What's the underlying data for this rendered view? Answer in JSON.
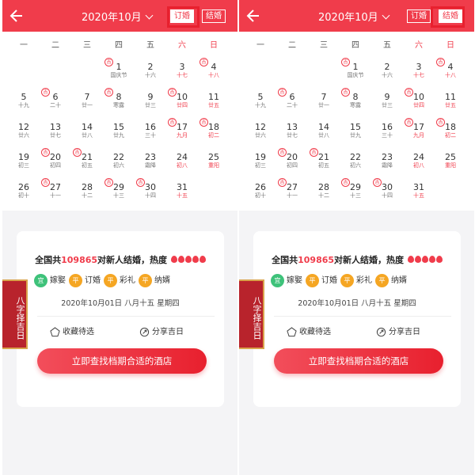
{
  "header": {
    "month": "2020年10月",
    "tab_dinghun": "订婚",
    "tab_jiehun": "结婚"
  },
  "weekdays": [
    "一",
    "二",
    "三",
    "四",
    "五",
    "六",
    "日"
  ],
  "ji_label": "吉",
  "days": [
    {
      "n": "1",
      "s": "国庆节",
      "red": false,
      "ji": true
    },
    {
      "n": "2",
      "s": "十六",
      "red": false,
      "ji": false
    },
    {
      "n": "3",
      "s": "十七",
      "red": true,
      "ji": false
    },
    {
      "n": "4",
      "s": "十八",
      "red": true,
      "ji": true
    },
    {
      "n": "5",
      "s": "十九",
      "red": false,
      "ji": false
    },
    {
      "n": "6",
      "s": "二十",
      "red": false,
      "ji": true
    },
    {
      "n": "7",
      "s": "廿一",
      "red": false,
      "ji": false
    },
    {
      "n": "8",
      "s": "寒露",
      "red": false,
      "ji": true
    },
    {
      "n": "9",
      "s": "廿三",
      "red": false,
      "ji": false
    },
    {
      "n": "10",
      "s": "廿四",
      "red": true,
      "ji": true
    },
    {
      "n": "11",
      "s": "廿五",
      "red": true,
      "ji": false
    },
    {
      "n": "12",
      "s": "廿六",
      "red": false,
      "ji": false
    },
    {
      "n": "13",
      "s": "廿七",
      "red": false,
      "ji": false
    },
    {
      "n": "14",
      "s": "廿八",
      "red": false,
      "ji": false
    },
    {
      "n": "15",
      "s": "廿九",
      "red": false,
      "ji": false
    },
    {
      "n": "16",
      "s": "三十",
      "red": false,
      "ji": false
    },
    {
      "n": "17",
      "s": "九月",
      "red": true,
      "ji": true
    },
    {
      "n": "18",
      "s": "初二",
      "red": true,
      "ji": true
    },
    {
      "n": "19",
      "s": "初三",
      "red": false,
      "ji": false
    },
    {
      "n": "20",
      "s": "初四",
      "red": false,
      "ji": true
    },
    {
      "n": "21",
      "s": "初五",
      "red": false,
      "ji": true
    },
    {
      "n": "22",
      "s": "初六",
      "red": false,
      "ji": false
    },
    {
      "n": "23",
      "s": "霜降",
      "red": false,
      "ji": false
    },
    {
      "n": "24",
      "s": "初八",
      "red": true,
      "ji": false
    },
    {
      "n": "25",
      "s": "重阳",
      "red": true,
      "ji": false
    },
    {
      "n": "26",
      "s": "初十",
      "red": false,
      "ji": false
    },
    {
      "n": "27",
      "s": "十一",
      "red": false,
      "ji": true
    },
    {
      "n": "28",
      "s": "十二",
      "red": false,
      "ji": false
    },
    {
      "n": "29",
      "s": "十三",
      "red": false,
      "ji": true
    },
    {
      "n": "30",
      "s": "十四",
      "red": false,
      "ji": true
    },
    {
      "n": "31",
      "s": "十五",
      "red": true,
      "ji": false
    }
  ],
  "card": {
    "headline_prefix": "全国共",
    "count": "109865",
    "headline_suffix": "对新人结婚，热度",
    "activities": [
      {
        "badge": "宜",
        "label": "嫁娶",
        "color": "green"
      },
      {
        "badge": "平",
        "label": "订婚",
        "color": "orange"
      },
      {
        "badge": "平",
        "label": "彩礼",
        "color": "orange"
      },
      {
        "badge": "平",
        "label": "纳婿",
        "color": "orange"
      }
    ],
    "date": "2020年10月01日  八月十五 星期四",
    "favorite": "收藏待选",
    "share": "分享吉日",
    "cta": "立即查找档期合适的酒店"
  },
  "sidetag": "八字择吉日",
  "colors": {
    "accent": "#f03c4b",
    "green": "#3ec27a",
    "orange": "#f5a623"
  }
}
